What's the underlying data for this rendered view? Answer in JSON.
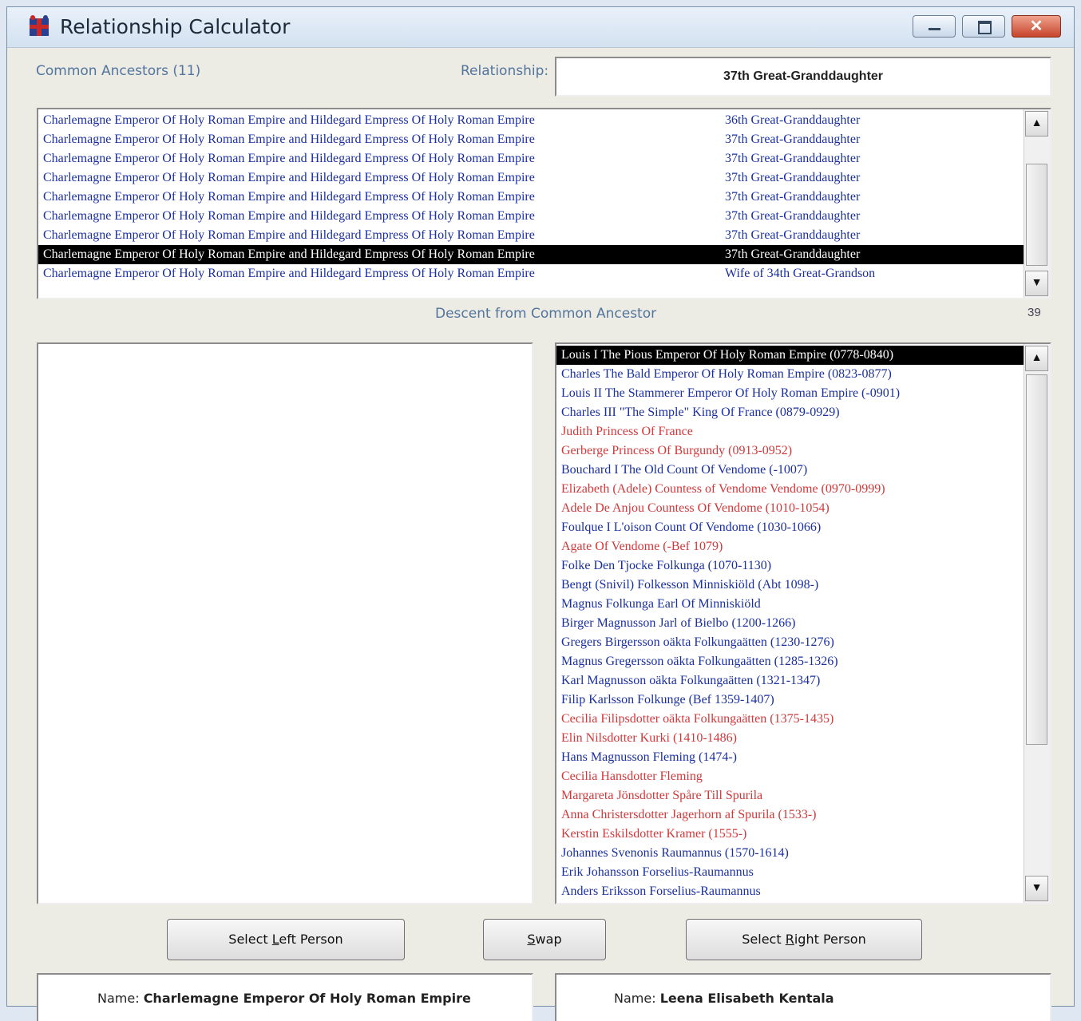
{
  "window": {
    "title": "Relationship Calculator"
  },
  "header": {
    "common_label": "Common Ancestors (11)",
    "relationship_label": "Relationship:",
    "relationship_value": "37th Great-Granddaughter"
  },
  "ancestors": [
    {
      "name": "Charlemagne Emperor Of Holy Roman Empire and Hildegard Empress Of Holy Roman Empire",
      "rel": "36th Great-Granddaughter"
    },
    {
      "name": "Charlemagne Emperor Of Holy Roman Empire and Hildegard Empress Of Holy Roman Empire",
      "rel": "37th Great-Granddaughter"
    },
    {
      "name": "Charlemagne Emperor Of Holy Roman Empire and Hildegard Empress Of Holy Roman Empire",
      "rel": "37th Great-Granddaughter"
    },
    {
      "name": "Charlemagne Emperor Of Holy Roman Empire and Hildegard Empress Of Holy Roman Empire",
      "rel": "37th Great-Granddaughter"
    },
    {
      "name": "Charlemagne Emperor Of Holy Roman Empire and Hildegard Empress Of Holy Roman Empire",
      "rel": "37th Great-Granddaughter"
    },
    {
      "name": "Charlemagne Emperor Of Holy Roman Empire and Hildegard Empress Of Holy Roman Empire",
      "rel": "37th Great-Granddaughter"
    },
    {
      "name": "Charlemagne Emperor Of Holy Roman Empire and Hildegard Empress Of Holy Roman Empire",
      "rel": "37th Great-Granddaughter"
    },
    {
      "name": "Charlemagne Emperor Of Holy Roman Empire and Hildegard Empress Of Holy Roman Empire",
      "rel": "37th Great-Granddaughter",
      "selected": true
    },
    {
      "name": "Charlemagne Emperor Of Holy Roman Empire and Hildegard Empress Of Holy Roman Empire",
      "rel": "Wife of 34th Great-Grandson"
    }
  ],
  "descent": {
    "label": "Descent from Common Ancestor",
    "count": "39",
    "items": [
      {
        "text": "Louis I The Pious Emperor Of Holy Roman Empire (0778-0840)",
        "color": "blue",
        "selected": true
      },
      {
        "text": "Charles The Bald Emperor Of Holy Roman Empire (0823-0877)",
        "color": "blue"
      },
      {
        "text": "Louis II The Stammerer Emperor Of Holy Roman Empire (-0901)",
        "color": "blue"
      },
      {
        "text": "Charles III \"The Simple\" King Of France (0879-0929)",
        "color": "blue"
      },
      {
        "text": "Judith Princess Of France",
        "color": "red"
      },
      {
        "text": "Gerberge Princess Of Burgundy (0913-0952)",
        "color": "red"
      },
      {
        "text": "Bouchard I The Old Count Of Vendome (-1007)",
        "color": "blue"
      },
      {
        "text": "Elizabeth (Adele) Countess of Vendome Vendome (0970-0999)",
        "color": "red"
      },
      {
        "text": "Adele De Anjou Countess Of Vendome (1010-1054)",
        "color": "red"
      },
      {
        "text": "Foulque I L'oison Count Of Vendome (1030-1066)",
        "color": "blue"
      },
      {
        "text": "Agate Of Vendome (-Bef 1079)",
        "color": "red"
      },
      {
        "text": "Folke Den Tjocke Folkunga (1070-1130)",
        "color": "blue"
      },
      {
        "text": "Bengt (Snivil) Folkesson Minniskiöld (Abt 1098-)",
        "color": "blue"
      },
      {
        "text": "Magnus Folkunga Earl Of Minniskiöld",
        "color": "blue"
      },
      {
        "text": "Birger Magnusson Jarl of Bielbo (1200-1266)",
        "color": "blue"
      },
      {
        "text": "Gregers Birgersson oäkta Folkungaätten (1230-1276)",
        "color": "blue"
      },
      {
        "text": "Magnus Gregersson oäkta Folkungaätten (1285-1326)",
        "color": "blue"
      },
      {
        "text": "Karl Magnusson oäkta Folkungaätten (1321-1347)",
        "color": "blue"
      },
      {
        "text": "Filip Karlsson Folkunge (Bef 1359-1407)",
        "color": "blue"
      },
      {
        "text": "Cecilia Filipsdotter oäkta Folkungaätten (1375-1435)",
        "color": "red"
      },
      {
        "text": "Elin Nilsdotter Kurki (1410-1486)",
        "color": "red"
      },
      {
        "text": "Hans Magnusson Fleming (1474-)",
        "color": "blue"
      },
      {
        "text": "Cecilia Hansdotter Fleming",
        "color": "red"
      },
      {
        "text": "Margareta Jönsdotter Spåre Till Spurila",
        "color": "red"
      },
      {
        "text": "Anna Christersdotter Jagerhorn af Spurila (1533-)",
        "color": "red"
      },
      {
        "text": "Kerstin Eskilsdotter Kramer (1555-)",
        "color": "red"
      },
      {
        "text": "Johannes Svenonis Raumannus (1570-1614)",
        "color": "blue"
      },
      {
        "text": "Erik Johansson Forselius-Raumannus",
        "color": "blue"
      },
      {
        "text": "Anders Eriksson Forselius-Raumannus",
        "color": "blue"
      }
    ]
  },
  "buttons": {
    "select_left": {
      "pre": "Select ",
      "ul": "L",
      "post": "eft Person"
    },
    "swap": {
      "pre": "",
      "ul": "S",
      "post": "wap"
    },
    "select_right": {
      "pre": "Select ",
      "ul": "R",
      "post": "ight Person"
    }
  },
  "left_person": {
    "label": "Name:",
    "name": "Charlemagne Emperor Of Holy Roman Empire"
  },
  "right_person": {
    "label": "Name:",
    "name": "Leena Elisabeth Kentala"
  }
}
